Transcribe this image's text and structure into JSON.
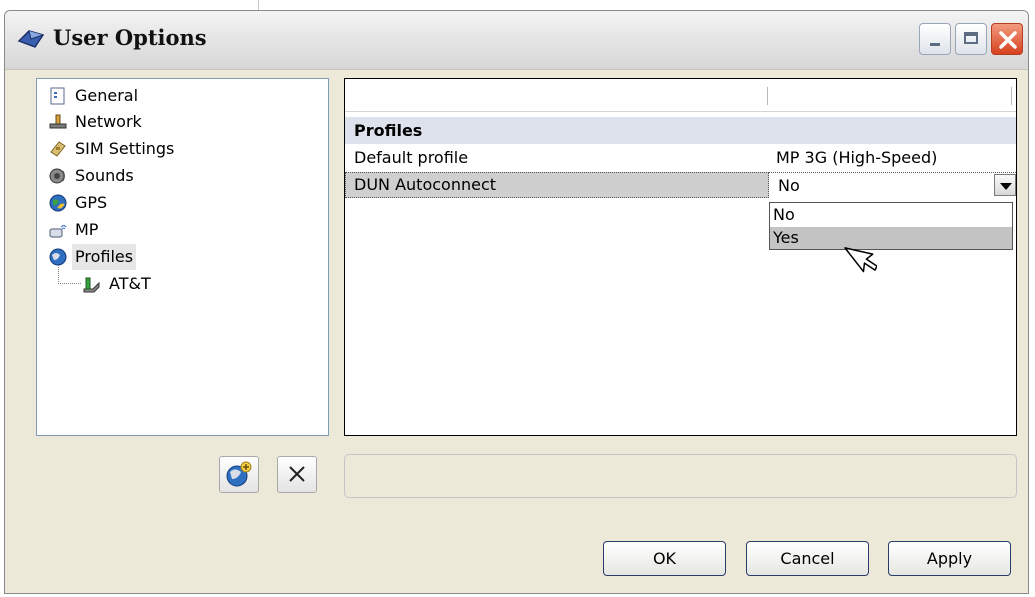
{
  "window": {
    "title": "User Options"
  },
  "tree": {
    "items": [
      {
        "label": "General",
        "icon": "general-icon"
      },
      {
        "label": "Network",
        "icon": "network-icon"
      },
      {
        "label": "SIM Settings",
        "icon": "sim-icon"
      },
      {
        "label": "Sounds",
        "icon": "sounds-icon"
      },
      {
        "label": "GPS",
        "icon": "gps-icon"
      },
      {
        "label": "MP",
        "icon": "mp-icon"
      },
      {
        "label": "Profiles",
        "icon": "profiles-icon",
        "selected": true
      },
      {
        "label": "AT&T",
        "icon": "att-profile-icon"
      }
    ]
  },
  "properties": {
    "category": "Profiles",
    "rows": [
      {
        "name": "Default profile",
        "value": "MP 3G (High-Speed)"
      },
      {
        "name": "DUN Autoconnect",
        "value": "No"
      }
    ],
    "dropdown_options": [
      "No",
      "Yes"
    ],
    "highlighted_option": "Yes"
  },
  "buttons": {
    "ok": "OK",
    "cancel": "Cancel",
    "apply": "Apply"
  },
  "colors": {
    "window_bg": "#ece9d8",
    "category_bg": "#dde2ec",
    "selection_gray": "#c4c4c4"
  }
}
